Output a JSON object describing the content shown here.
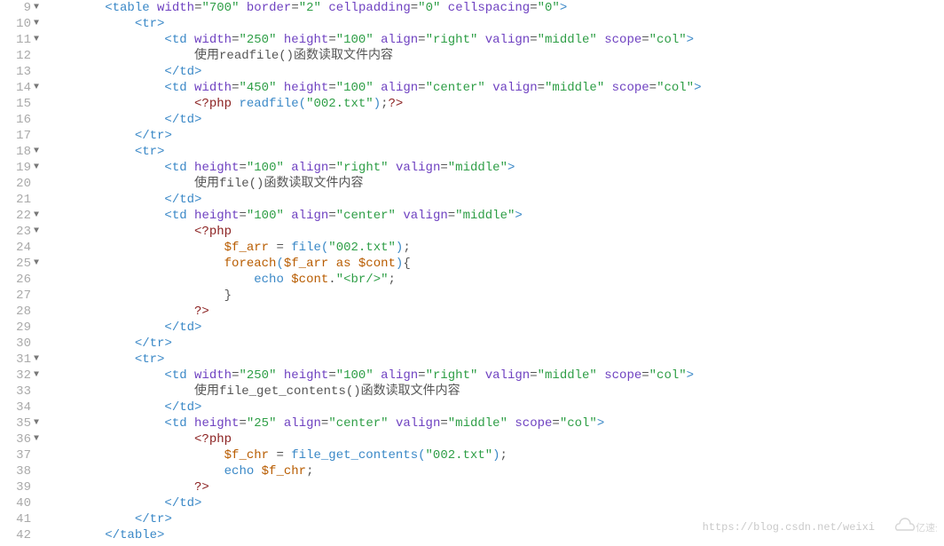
{
  "lines": [
    {
      "num": "9",
      "fold": true,
      "tokens": [
        {
          "t": "bracket",
          "v": "<"
        },
        {
          "t": "tag",
          "v": "table"
        },
        {
          "t": "txt",
          "v": " "
        },
        {
          "t": "attr",
          "v": "width"
        },
        {
          "t": "op",
          "v": "="
        },
        {
          "t": "str",
          "v": "\"700\""
        },
        {
          "t": "txt",
          "v": " "
        },
        {
          "t": "attr",
          "v": "border"
        },
        {
          "t": "op",
          "v": "="
        },
        {
          "t": "str",
          "v": "\"2\""
        },
        {
          "t": "txt",
          "v": " "
        },
        {
          "t": "attr",
          "v": "cellpadding"
        },
        {
          "t": "op",
          "v": "="
        },
        {
          "t": "str",
          "v": "\"0\""
        },
        {
          "t": "txt",
          "v": " "
        },
        {
          "t": "attr",
          "v": "cellspacing"
        },
        {
          "t": "op",
          "v": "="
        },
        {
          "t": "str",
          "v": "\"0\""
        },
        {
          "t": "bracket",
          "v": ">"
        }
      ],
      "indent": 8
    },
    {
      "num": "10",
      "fold": true,
      "tokens": [
        {
          "t": "bracket",
          "v": "<"
        },
        {
          "t": "tag",
          "v": "tr"
        },
        {
          "t": "bracket",
          "v": ">"
        }
      ],
      "indent": 12
    },
    {
      "num": "11",
      "fold": true,
      "tokens": [
        {
          "t": "bracket",
          "v": "<"
        },
        {
          "t": "tag",
          "v": "td"
        },
        {
          "t": "txt",
          "v": " "
        },
        {
          "t": "attr",
          "v": "width"
        },
        {
          "t": "op",
          "v": "="
        },
        {
          "t": "str",
          "v": "\"250\""
        },
        {
          "t": "txt",
          "v": " "
        },
        {
          "t": "attr",
          "v": "height"
        },
        {
          "t": "op",
          "v": "="
        },
        {
          "t": "str",
          "v": "\"100\""
        },
        {
          "t": "txt",
          "v": " "
        },
        {
          "t": "attr",
          "v": "align"
        },
        {
          "t": "op",
          "v": "="
        },
        {
          "t": "str",
          "v": "\"right\""
        },
        {
          "t": "txt",
          "v": " "
        },
        {
          "t": "attr",
          "v": "valign"
        },
        {
          "t": "op",
          "v": "="
        },
        {
          "t": "str",
          "v": "\"middle\""
        },
        {
          "t": "txt",
          "v": " "
        },
        {
          "t": "attr",
          "v": "scope"
        },
        {
          "t": "op",
          "v": "="
        },
        {
          "t": "str",
          "v": "\"col\""
        },
        {
          "t": "bracket",
          "v": ">"
        }
      ],
      "indent": 16
    },
    {
      "num": "12",
      "fold": false,
      "tokens": [
        {
          "t": "txt",
          "v": "使用readfile()函数读取文件内容"
        }
      ],
      "indent": 20
    },
    {
      "num": "13",
      "fold": false,
      "tokens": [
        {
          "t": "bracket",
          "v": "</"
        },
        {
          "t": "tag",
          "v": "td"
        },
        {
          "t": "bracket",
          "v": ">"
        }
      ],
      "indent": 16
    },
    {
      "num": "14",
      "fold": true,
      "tokens": [
        {
          "t": "bracket",
          "v": "<"
        },
        {
          "t": "tag",
          "v": "td"
        },
        {
          "t": "txt",
          "v": " "
        },
        {
          "t": "attr",
          "v": "width"
        },
        {
          "t": "op",
          "v": "="
        },
        {
          "t": "str",
          "v": "\"450\""
        },
        {
          "t": "txt",
          "v": " "
        },
        {
          "t": "attr",
          "v": "height"
        },
        {
          "t": "op",
          "v": "="
        },
        {
          "t": "str",
          "v": "\"100\""
        },
        {
          "t": "txt",
          "v": " "
        },
        {
          "t": "attr",
          "v": "align"
        },
        {
          "t": "op",
          "v": "="
        },
        {
          "t": "str",
          "v": "\"center\""
        },
        {
          "t": "txt",
          "v": " "
        },
        {
          "t": "attr",
          "v": "valign"
        },
        {
          "t": "op",
          "v": "="
        },
        {
          "t": "str",
          "v": "\"middle\""
        },
        {
          "t": "txt",
          "v": " "
        },
        {
          "t": "attr",
          "v": "scope"
        },
        {
          "t": "op",
          "v": "="
        },
        {
          "t": "str",
          "v": "\"col\""
        },
        {
          "t": "bracket",
          "v": ">"
        }
      ],
      "indent": 16
    },
    {
      "num": "15",
      "fold": false,
      "tokens": [
        {
          "t": "php",
          "v": "<?php"
        },
        {
          "t": "txt",
          "v": " "
        },
        {
          "t": "tag",
          "v": "readfile"
        },
        {
          "t": "tag",
          "v": "("
        },
        {
          "t": "str",
          "v": "\"002.txt\""
        },
        {
          "t": "tag",
          "v": ")"
        },
        {
          "t": "txt",
          "v": ";"
        },
        {
          "t": "php",
          "v": "?>"
        }
      ],
      "indent": 20
    },
    {
      "num": "16",
      "fold": false,
      "tokens": [
        {
          "t": "bracket",
          "v": "</"
        },
        {
          "t": "tag",
          "v": "td"
        },
        {
          "t": "bracket",
          "v": ">"
        }
      ],
      "indent": 16
    },
    {
      "num": "17",
      "fold": false,
      "tokens": [
        {
          "t": "bracket",
          "v": "</"
        },
        {
          "t": "tag",
          "v": "tr"
        },
        {
          "t": "bracket",
          "v": ">"
        }
      ],
      "indent": 12
    },
    {
      "num": "18",
      "fold": true,
      "tokens": [
        {
          "t": "bracket",
          "v": "<"
        },
        {
          "t": "tag",
          "v": "tr"
        },
        {
          "t": "bracket",
          "v": ">"
        }
      ],
      "indent": 12
    },
    {
      "num": "19",
      "fold": true,
      "tokens": [
        {
          "t": "bracket",
          "v": "<"
        },
        {
          "t": "tag",
          "v": "td"
        },
        {
          "t": "txt",
          "v": " "
        },
        {
          "t": "attr",
          "v": "height"
        },
        {
          "t": "op",
          "v": "="
        },
        {
          "t": "str",
          "v": "\"100\""
        },
        {
          "t": "txt",
          "v": " "
        },
        {
          "t": "attr",
          "v": "align"
        },
        {
          "t": "op",
          "v": "="
        },
        {
          "t": "str",
          "v": "\"right\""
        },
        {
          "t": "txt",
          "v": " "
        },
        {
          "t": "attr",
          "v": "valign"
        },
        {
          "t": "op",
          "v": "="
        },
        {
          "t": "str",
          "v": "\"middle\""
        },
        {
          "t": "bracket",
          "v": ">"
        }
      ],
      "indent": 16
    },
    {
      "num": "20",
      "fold": false,
      "tokens": [
        {
          "t": "txt",
          "v": "使用file()函数读取文件内容"
        }
      ],
      "indent": 20
    },
    {
      "num": "21",
      "fold": false,
      "tokens": [
        {
          "t": "bracket",
          "v": "</"
        },
        {
          "t": "tag",
          "v": "td"
        },
        {
          "t": "bracket",
          "v": ">"
        }
      ],
      "indent": 16
    },
    {
      "num": "22",
      "fold": true,
      "tokens": [
        {
          "t": "bracket",
          "v": "<"
        },
        {
          "t": "tag",
          "v": "td"
        },
        {
          "t": "txt",
          "v": " "
        },
        {
          "t": "attr",
          "v": "height"
        },
        {
          "t": "op",
          "v": "="
        },
        {
          "t": "str",
          "v": "\"100\""
        },
        {
          "t": "txt",
          "v": " "
        },
        {
          "t": "attr",
          "v": "align"
        },
        {
          "t": "op",
          "v": "="
        },
        {
          "t": "str",
          "v": "\"center\""
        },
        {
          "t": "txt",
          "v": " "
        },
        {
          "t": "attr",
          "v": "valign"
        },
        {
          "t": "op",
          "v": "="
        },
        {
          "t": "str",
          "v": "\"middle\""
        },
        {
          "t": "bracket",
          "v": ">"
        }
      ],
      "indent": 16
    },
    {
      "num": "23",
      "fold": true,
      "tokens": [
        {
          "t": "php",
          "v": "<?php"
        }
      ],
      "indent": 20
    },
    {
      "num": "24",
      "fold": false,
      "tokens": [
        {
          "t": "key",
          "v": "$f_arr"
        },
        {
          "t": "txt",
          "v": " "
        },
        {
          "t": "op",
          "v": "="
        },
        {
          "t": "txt",
          "v": " "
        },
        {
          "t": "tag",
          "v": "file"
        },
        {
          "t": "tag",
          "v": "("
        },
        {
          "t": "str",
          "v": "\"002.txt\""
        },
        {
          "t": "tag",
          "v": ")"
        },
        {
          "t": "txt",
          "v": ";"
        }
      ],
      "indent": 24
    },
    {
      "num": "25",
      "fold": true,
      "tokens": [
        {
          "t": "key",
          "v": "foreach"
        },
        {
          "t": "tag",
          "v": "("
        },
        {
          "t": "key",
          "v": "$f_arr"
        },
        {
          "t": "txt",
          "v": " "
        },
        {
          "t": "key",
          "v": "as"
        },
        {
          "t": "txt",
          "v": " "
        },
        {
          "t": "key",
          "v": "$cont"
        },
        {
          "t": "tag",
          "v": ")"
        },
        {
          "t": "txt",
          "v": "{"
        }
      ],
      "indent": 24
    },
    {
      "num": "26",
      "fold": false,
      "tokens": [
        {
          "t": "tag",
          "v": "echo"
        },
        {
          "t": "txt",
          "v": " "
        },
        {
          "t": "key",
          "v": "$cont"
        },
        {
          "t": "txt",
          "v": "."
        },
        {
          "t": "str",
          "v": "\"<br/>\""
        },
        {
          "t": "txt",
          "v": ";"
        }
      ],
      "indent": 28
    },
    {
      "num": "27",
      "fold": false,
      "tokens": [
        {
          "t": "txt",
          "v": "}"
        }
      ],
      "indent": 24
    },
    {
      "num": "28",
      "fold": false,
      "tokens": [
        {
          "t": "php",
          "v": "?>"
        }
      ],
      "indent": 20
    },
    {
      "num": "29",
      "fold": false,
      "tokens": [
        {
          "t": "bracket",
          "v": "</"
        },
        {
          "t": "tag",
          "v": "td"
        },
        {
          "t": "bracket",
          "v": ">"
        }
      ],
      "indent": 16
    },
    {
      "num": "30",
      "fold": false,
      "tokens": [
        {
          "t": "bracket",
          "v": "</"
        },
        {
          "t": "tag",
          "v": "tr"
        },
        {
          "t": "bracket",
          "v": ">"
        }
      ],
      "indent": 12
    },
    {
      "num": "31",
      "fold": true,
      "tokens": [
        {
          "t": "bracket",
          "v": "<"
        },
        {
          "t": "tag",
          "v": "tr"
        },
        {
          "t": "bracket",
          "v": ">"
        }
      ],
      "indent": 12
    },
    {
      "num": "32",
      "fold": true,
      "tokens": [
        {
          "t": "bracket",
          "v": "<"
        },
        {
          "t": "tag",
          "v": "td"
        },
        {
          "t": "txt",
          "v": " "
        },
        {
          "t": "attr",
          "v": "width"
        },
        {
          "t": "op",
          "v": "="
        },
        {
          "t": "str",
          "v": "\"250\""
        },
        {
          "t": "txt",
          "v": " "
        },
        {
          "t": "attr",
          "v": "height"
        },
        {
          "t": "op",
          "v": "="
        },
        {
          "t": "str",
          "v": "\"100\""
        },
        {
          "t": "txt",
          "v": " "
        },
        {
          "t": "attr",
          "v": "align"
        },
        {
          "t": "op",
          "v": "="
        },
        {
          "t": "str",
          "v": "\"right\""
        },
        {
          "t": "txt",
          "v": " "
        },
        {
          "t": "attr",
          "v": "valign"
        },
        {
          "t": "op",
          "v": "="
        },
        {
          "t": "str",
          "v": "\"middle\""
        },
        {
          "t": "txt",
          "v": " "
        },
        {
          "t": "attr",
          "v": "scope"
        },
        {
          "t": "op",
          "v": "="
        },
        {
          "t": "str",
          "v": "\"col\""
        },
        {
          "t": "bracket",
          "v": ">"
        }
      ],
      "indent": 16
    },
    {
      "num": "33",
      "fold": false,
      "tokens": [
        {
          "t": "txt",
          "v": "使用file_get_contents()函数读取文件内容"
        }
      ],
      "indent": 20
    },
    {
      "num": "34",
      "fold": false,
      "tokens": [
        {
          "t": "bracket",
          "v": "</"
        },
        {
          "t": "tag",
          "v": "td"
        },
        {
          "t": "bracket",
          "v": ">"
        }
      ],
      "indent": 16
    },
    {
      "num": "35",
      "fold": true,
      "tokens": [
        {
          "t": "bracket",
          "v": "<"
        },
        {
          "t": "tag",
          "v": "td"
        },
        {
          "t": "txt",
          "v": " "
        },
        {
          "t": "attr",
          "v": "height"
        },
        {
          "t": "op",
          "v": "="
        },
        {
          "t": "str",
          "v": "\"25\""
        },
        {
          "t": "txt",
          "v": " "
        },
        {
          "t": "attr",
          "v": "align"
        },
        {
          "t": "op",
          "v": "="
        },
        {
          "t": "str",
          "v": "\"center\""
        },
        {
          "t": "txt",
          "v": " "
        },
        {
          "t": "attr",
          "v": "valign"
        },
        {
          "t": "op",
          "v": "="
        },
        {
          "t": "str",
          "v": "\"middle\""
        },
        {
          "t": "txt",
          "v": " "
        },
        {
          "t": "attr",
          "v": "scope"
        },
        {
          "t": "op",
          "v": "="
        },
        {
          "t": "str",
          "v": "\"col\""
        },
        {
          "t": "bracket",
          "v": ">"
        }
      ],
      "indent": 16
    },
    {
      "num": "36",
      "fold": true,
      "tokens": [
        {
          "t": "php",
          "v": "<?php"
        }
      ],
      "indent": 20
    },
    {
      "num": "37",
      "fold": false,
      "tokens": [
        {
          "t": "key",
          "v": "$f_chr"
        },
        {
          "t": "txt",
          "v": " "
        },
        {
          "t": "op",
          "v": "="
        },
        {
          "t": "txt",
          "v": " "
        },
        {
          "t": "tag",
          "v": "file_get_contents"
        },
        {
          "t": "tag",
          "v": "("
        },
        {
          "t": "str",
          "v": "\"002.txt\""
        },
        {
          "t": "tag",
          "v": ")"
        },
        {
          "t": "txt",
          "v": ";"
        }
      ],
      "indent": 24
    },
    {
      "num": "38",
      "fold": false,
      "tokens": [
        {
          "t": "tag",
          "v": "echo"
        },
        {
          "t": "txt",
          "v": " "
        },
        {
          "t": "key",
          "v": "$f_chr"
        },
        {
          "t": "txt",
          "v": ";"
        }
      ],
      "indent": 24
    },
    {
      "num": "39",
      "fold": false,
      "tokens": [
        {
          "t": "php",
          "v": "?>"
        }
      ],
      "indent": 20
    },
    {
      "num": "40",
      "fold": false,
      "tokens": [
        {
          "t": "bracket",
          "v": "</"
        },
        {
          "t": "tag",
          "v": "td"
        },
        {
          "t": "bracket",
          "v": ">"
        }
      ],
      "indent": 16
    },
    {
      "num": "41",
      "fold": false,
      "tokens": [
        {
          "t": "bracket",
          "v": "</"
        },
        {
          "t": "tag",
          "v": "tr"
        },
        {
          "t": "bracket",
          "v": ">"
        }
      ],
      "indent": 12
    },
    {
      "num": "42",
      "fold": false,
      "tokens": [
        {
          "t": "bracket",
          "v": "</"
        },
        {
          "t": "tag",
          "v": "table"
        },
        {
          "t": "bracket",
          "v": ">"
        }
      ],
      "indent": 8
    }
  ],
  "watermark": {
    "text": "https://blog.csdn.net/weixi",
    "brand": "亿速云"
  }
}
